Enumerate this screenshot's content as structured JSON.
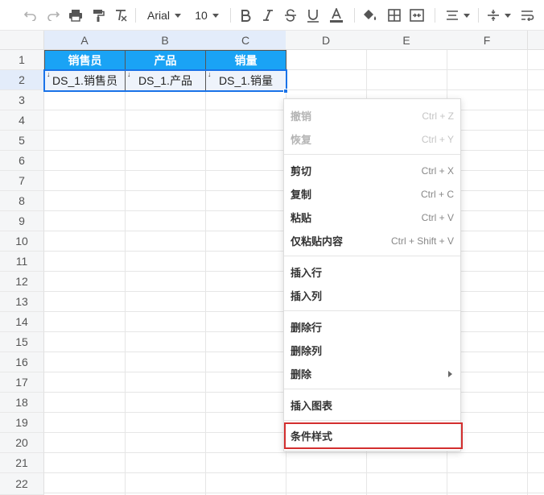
{
  "toolbar": {
    "font_name": "Arial",
    "font_size": "10",
    "icons": [
      "undo-icon",
      "redo-icon",
      "print-icon",
      "format-painter-icon",
      "clear-format-icon",
      "bold-icon",
      "italic-icon",
      "strikethrough-icon",
      "underline-icon",
      "font-color-icon",
      "fill-color-icon",
      "borders-icon",
      "merge-cells-icon",
      "align-horizontal-icon",
      "align-vertical-icon",
      "wrap-text-icon"
    ]
  },
  "grid": {
    "columns": [
      "A",
      "B",
      "C",
      "D",
      "E",
      "F"
    ],
    "rows": [
      "1",
      "2",
      "3",
      "4",
      "5",
      "6",
      "7",
      "8",
      "9",
      "10",
      "11",
      "12",
      "13",
      "14",
      "15",
      "16",
      "17",
      "18",
      "19",
      "20",
      "21",
      "22"
    ],
    "header_cells": [
      "销售员",
      "产品",
      "销量"
    ],
    "data_cells": [
      "DS_1.销售员",
      "DS_1.产品",
      "DS_1.销量"
    ],
    "header_color": "#1aa3f5",
    "selection_color": "#1a73e8"
  },
  "context_menu": {
    "items": [
      {
        "label": "撤销",
        "shortcut": "Ctrl + Z",
        "disabled": true
      },
      {
        "label": "恢复",
        "shortcut": "Ctrl + Y",
        "disabled": true
      },
      {
        "label": "剪切",
        "shortcut": "Ctrl + X",
        "disabled": false
      },
      {
        "label": "复制",
        "shortcut": "Ctrl + C",
        "disabled": false
      },
      {
        "label": "粘贴",
        "shortcut": "Ctrl + V",
        "disabled": false
      },
      {
        "label": "仅粘贴内容",
        "shortcut": "Ctrl + Shift + V",
        "disabled": false
      },
      {
        "label": "插入行",
        "shortcut": "",
        "disabled": false
      },
      {
        "label": "插入列",
        "shortcut": "",
        "disabled": false
      },
      {
        "label": "删除行",
        "shortcut": "",
        "disabled": false
      },
      {
        "label": "删除列",
        "shortcut": "",
        "disabled": false
      },
      {
        "label": "删除",
        "shortcut": "",
        "disabled": false,
        "submenu": true
      },
      {
        "label": "插入图表",
        "shortcut": "",
        "disabled": false
      },
      {
        "label": "条件样式",
        "shortcut": "",
        "disabled": false,
        "highlighted": true
      }
    ],
    "highlight_color": "#d32f2f"
  }
}
